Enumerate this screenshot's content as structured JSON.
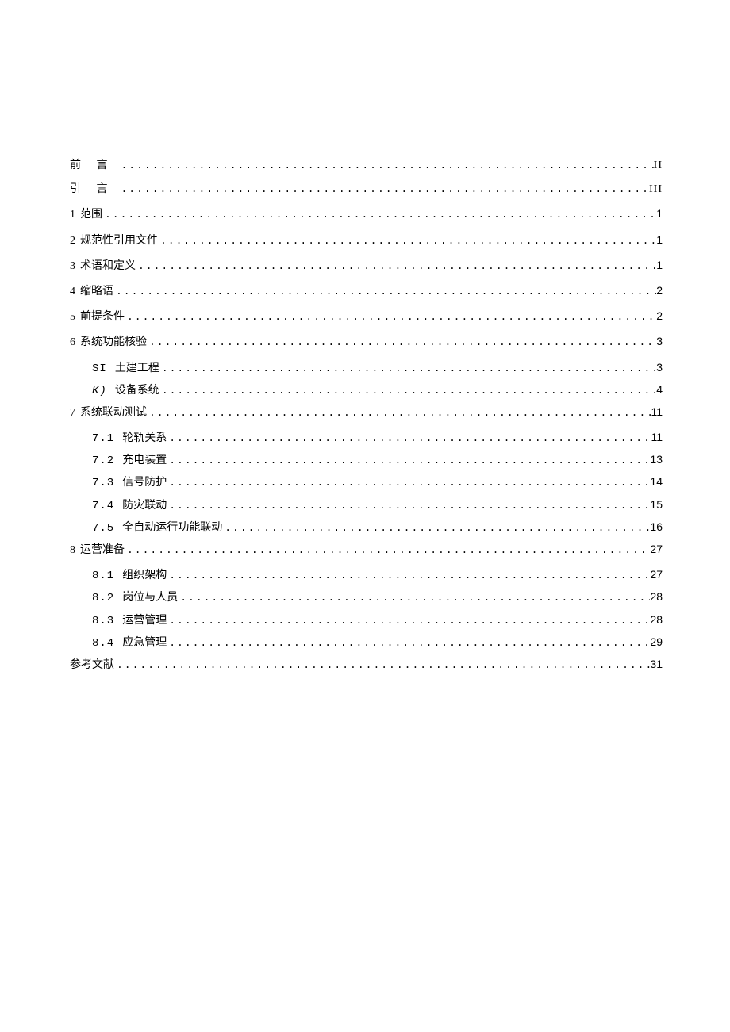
{
  "entries": [
    {
      "num": "",
      "title": "前 言",
      "page": "II",
      "level": 0,
      "spaced": true,
      "roman": true
    },
    {
      "num": "",
      "title": "引 言",
      "page": "III",
      "level": 0,
      "spaced": true,
      "roman": true
    },
    {
      "num": "1",
      "title": "范围",
      "page": "1",
      "level": 0
    },
    {
      "num": "2",
      "title": "规范性引用文件",
      "page": "1",
      "level": 0
    },
    {
      "num": "3",
      "title": "术语和定义",
      "page": "1",
      "level": 0
    },
    {
      "num": "4",
      "title": "缩略语",
      "page": "2",
      "level": 0
    },
    {
      "num": "5",
      "title": "前提条件",
      "page": "2",
      "level": 0
    },
    {
      "num": "6",
      "title": "系统功能核验",
      "page": "3",
      "level": 0
    },
    {
      "num": "SI",
      "title": "土建工程",
      "page": "3",
      "level": 1
    },
    {
      "num": "K)",
      "title": "设备系统",
      "page": "4",
      "level": 1,
      "italic": true
    },
    {
      "num": "7",
      "title": "系统联动测试",
      "page": "11",
      "level": 0
    },
    {
      "num": "7.1",
      "title": "轮轨关系",
      "page": "11",
      "level": 1
    },
    {
      "num": "7.2",
      "title": "充电装置",
      "page": "13",
      "level": 1
    },
    {
      "num": "7.3",
      "title": "信号防护",
      "page": "14",
      "level": 1
    },
    {
      "num": "7.4",
      "title": "防灾联动",
      "page": "15",
      "level": 1
    },
    {
      "num": "7.5",
      "title": "全自动运行功能联动",
      "page": "16",
      "level": 1
    },
    {
      "num": "8",
      "title": "运营准备",
      "page": "27",
      "level": 0
    },
    {
      "num": "8.1",
      "title": "组织架构",
      "page": "27",
      "level": 1
    },
    {
      "num": "8.2",
      "title": "岗位与人员",
      "page": "28",
      "level": 1
    },
    {
      "num": "8.3",
      "title": "运营管理",
      "page": "28",
      "level": 1
    },
    {
      "num": "8.4",
      "title": "应急管理",
      "page": "29",
      "level": 1
    },
    {
      "num": "",
      "title": "参考文献",
      "page": "31",
      "level": 0
    }
  ]
}
